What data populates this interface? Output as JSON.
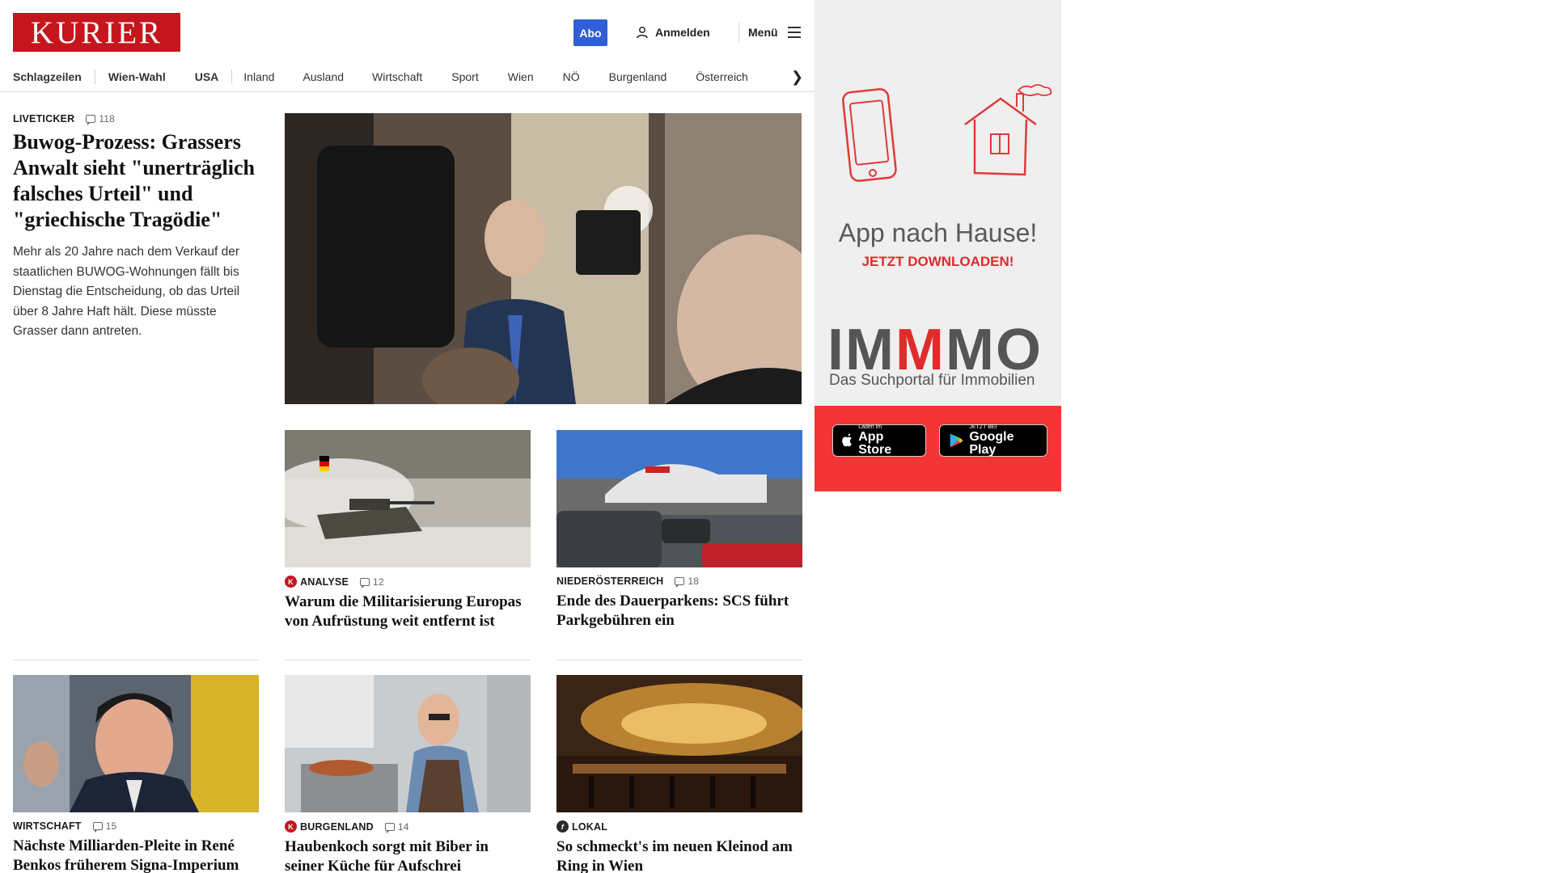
{
  "header": {
    "logo": "KURIER",
    "abo_label": "Abo",
    "login_label": "Anmelden",
    "menu_label": "Menü"
  },
  "nav": {
    "items": [
      "Schlagzeilen",
      "Wien-Wahl",
      "USA",
      "Inland",
      "Ausland",
      "Wirtschaft",
      "Sport",
      "Wien",
      "NÖ",
      "Burgenland",
      "Österreich"
    ]
  },
  "lead": {
    "kicker": "LIVETICKER",
    "comments": "118",
    "title": "Buwog-Prozess: Grassers Anwalt sieht \"unerträglich falsches Urteil\" und \"griechische Tragödie\"",
    "text": "Mehr als 20 Jahre nach dem Verkauf der staatlichen BUWOG-Wohnungen fällt bis Dienstag die Entscheidung, ob das Urteil über 8 Jahre Haft hält. Diese müsste Grasser dann antreten."
  },
  "cards": [
    {
      "badge": "K",
      "kicker": "ANALYSE",
      "comments": "12",
      "title": "Warum die Militarisierung Europas von Aufrüstung weit entfernt ist"
    },
    {
      "badge": "",
      "kicker": "NIEDERÖSTERREICH",
      "comments": "18",
      "title": "Ende des Dauerparkens: SCS führt Parkgebühren ein"
    },
    {
      "badge": "",
      "kicker": "WIRTSCHAFT",
      "comments": "15",
      "title": "Nächste Milliarden-Pleite in René Benkos früherem Signa-Imperium"
    },
    {
      "badge": "K",
      "kicker": "BURGENLAND",
      "comments": "14",
      "title": "Haubenkoch sorgt mit Biber in seiner Küche für Aufschrei"
    },
    {
      "badge": "f",
      "kicker": "LOKAL",
      "comments": "",
      "title": "So schmeckt's im neuen Kleinod am Ring in Wien"
    }
  ],
  "ad": {
    "headline": "App nach Hause!",
    "cta": "JETZT DOWNLOADEN!",
    "brand_a": "IM",
    "brand_m": "M",
    "brand_b": "MO",
    "tagline": "Das Suchportal für Immobilien",
    "appstore_small": "Laden im",
    "appstore_big": "App Store",
    "googleplay_small": "JETZT BEI",
    "googleplay_big": "Google Play"
  },
  "colors": {
    "brand": "#c4161c",
    "abo": "#2f5fd6",
    "ad_red": "#f43535"
  }
}
